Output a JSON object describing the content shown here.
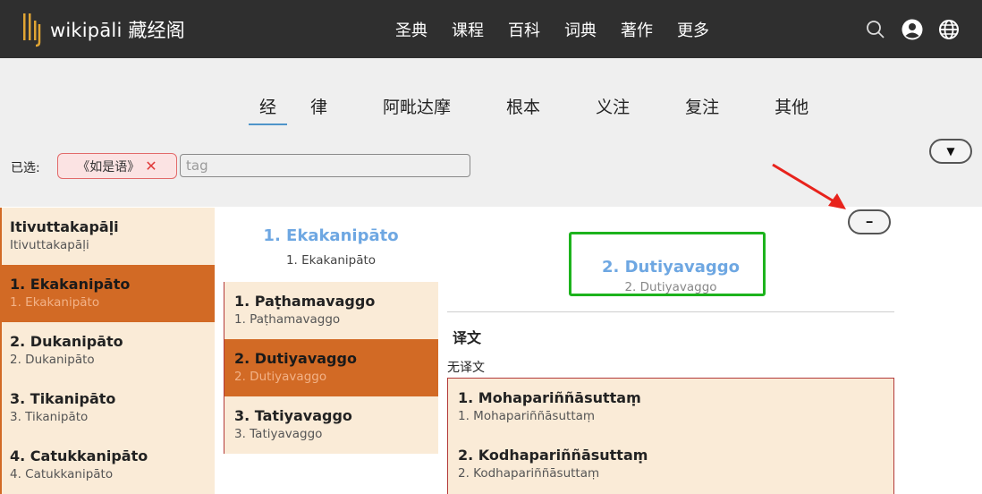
{
  "header": {
    "brand": "wikipāli 藏经阁",
    "nav": [
      "圣典",
      "课程",
      "百科",
      "词典",
      "著作",
      "更多"
    ],
    "icons": [
      "search-icon",
      "user-icon",
      "globe-icon"
    ]
  },
  "filter": {
    "tabs": [
      "经",
      "律",
      "阿毗达摩",
      "根本",
      "义注",
      "复注",
      "其他"
    ],
    "active_tab": "经",
    "selected_label": "已选:",
    "chip_label": "《如是语》",
    "chip_remove": "✕",
    "tag_placeholder": "tag",
    "expand_glyph": "▼",
    "collapse_glyph": "━"
  },
  "col1": {
    "items": [
      {
        "title": "Itivuttakapāḷi",
        "sub": "Itivuttakapāḷi",
        "active": false
      },
      {
        "title": "1. Ekakanipāto",
        "sub": "1. Ekakanipāto",
        "active": true
      },
      {
        "title": "2. Dukanipāto",
        "sub": "2. Dukanipāto",
        "active": false
      },
      {
        "title": "3. Tikanipāto",
        "sub": "3. Tikanipāto",
        "active": false
      },
      {
        "title": "4. Catukkanipāto",
        "sub": "4. Catukkanipāto",
        "active": false
      }
    ]
  },
  "col2": {
    "head_title": "1. Ekakanipāto",
    "head_sub": "1. Ekakanipāto",
    "items": [
      {
        "title": "1. Paṭhamavaggo",
        "sub": "1. Paṭhamavaggo",
        "active": false
      },
      {
        "title": "2. Dutiyavaggo",
        "sub": "2. Dutiyavaggo",
        "active": true
      },
      {
        "title": "3. Tatiyavaggo",
        "sub": "3. Tatiyavaggo",
        "active": false
      }
    ]
  },
  "col3": {
    "head_title": "2. Dutiyavaggo",
    "head_sub": "2. Dutiyavaggo",
    "section_title": "译文",
    "no_translation": "无译文",
    "items": [
      {
        "title": "1. Mohapariññāsuttaṃ",
        "sub": "1. Mohapariññāsuttaṃ",
        "active": false
      },
      {
        "title": "2. Kodhapariññāsuttaṃ",
        "sub": "2. Kodhapariññāsuttaṃ",
        "active": false
      }
    ]
  },
  "colors": {
    "header_bg": "#2f2f2f",
    "filter_bg": "#efefef",
    "item_bg": "#faebd7",
    "item_active_bg": "#d26a25",
    "heading_blue": "#6ea7e2",
    "highlight_green": "#1db31d",
    "arrow_red": "#e8231c"
  }
}
